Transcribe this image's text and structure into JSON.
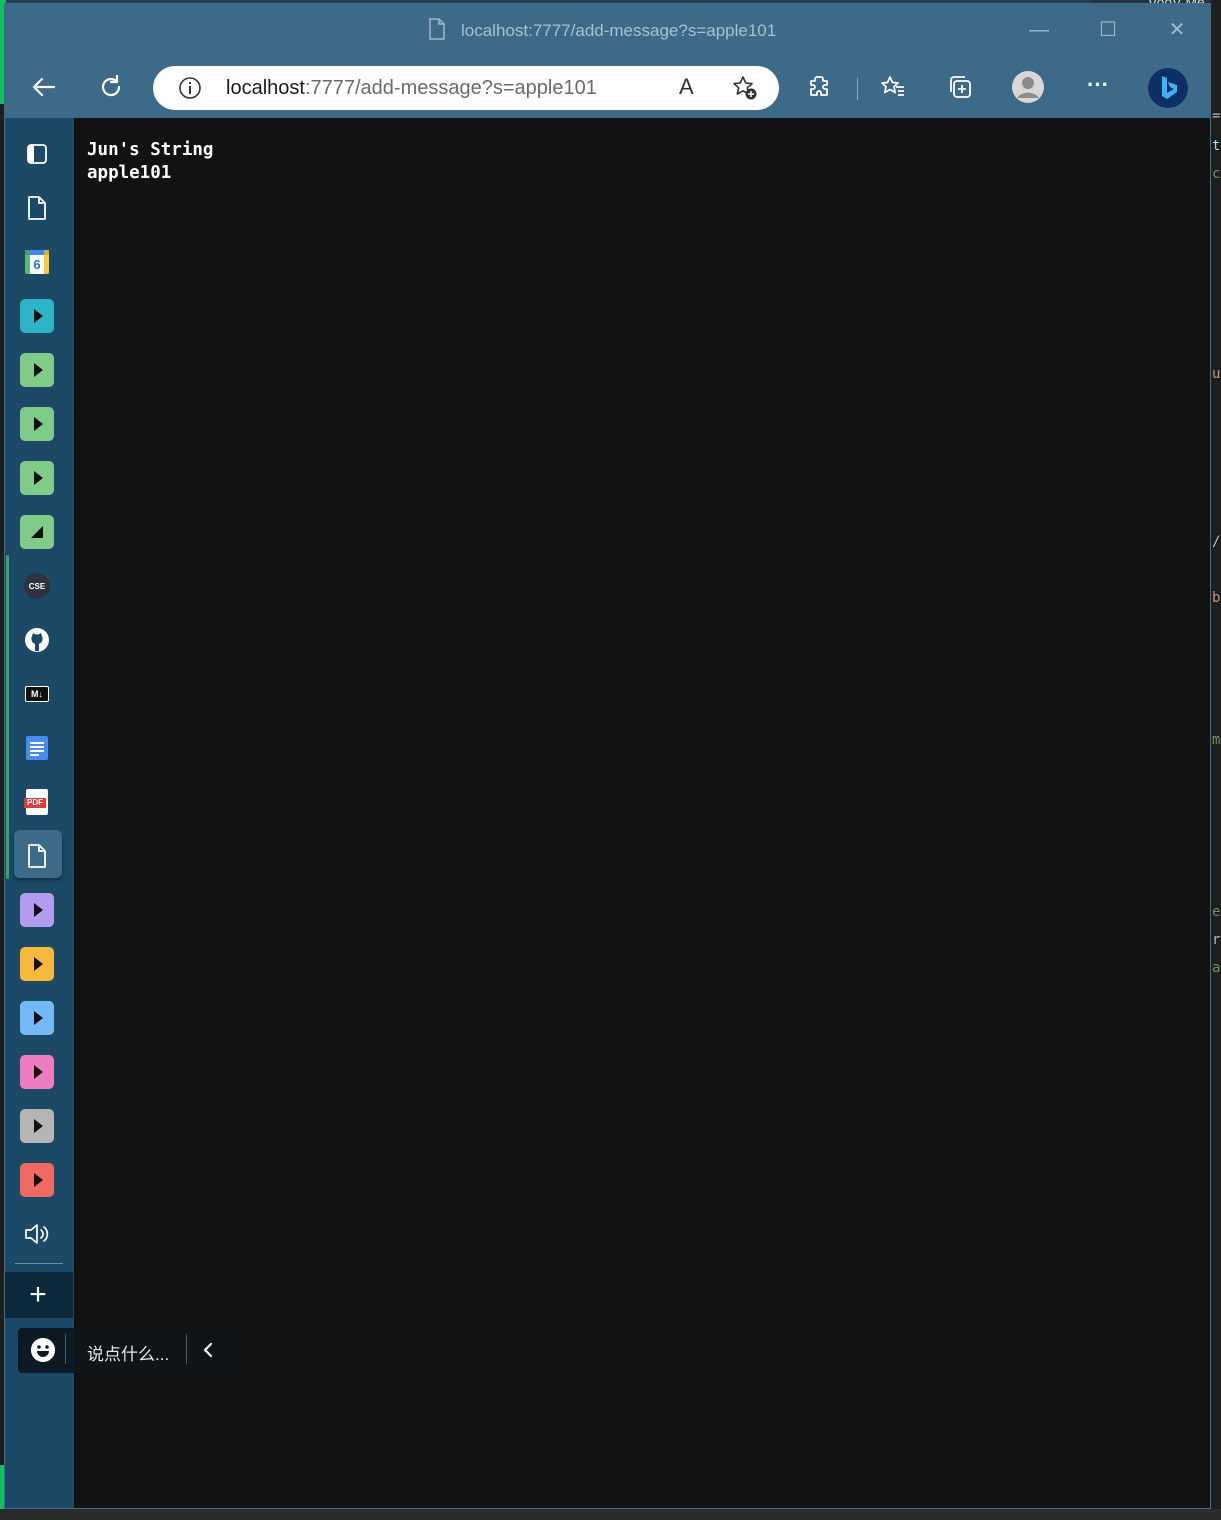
{
  "window": {
    "title": "localhost:7777/add-message?s=apple101",
    "minimize_label": "—",
    "maximize_label": "☐",
    "close_label": "✕"
  },
  "toolbar": {
    "url_host": "localhost",
    "url_rest": ":7777/add-message?s=apple101",
    "icons": [
      "back-icon",
      "refresh-icon",
      "info-icon",
      "read-aloud-icon",
      "add-favorite-icon",
      "extensions-icon",
      "favorites-icon",
      "collections-icon",
      "profile-icon",
      "more-icon",
      "bing-icon"
    ],
    "read_aloud_label": "A",
    "more_label": "···"
  },
  "sidebar": {
    "items": [
      {
        "name": "tab-actions",
        "icon": "tab-actions-icon"
      },
      {
        "name": "page",
        "icon": "page-icon"
      },
      {
        "name": "calendar",
        "icon": "calendar-icon",
        "badge": "6",
        "color": "#4285f4"
      },
      {
        "name": "app-teal",
        "icon": "play-icon",
        "color": "#2cb5c6"
      },
      {
        "name": "app-green-1",
        "icon": "play-icon",
        "color": "#7ecb8a"
      },
      {
        "name": "app-green-2",
        "icon": "play-icon",
        "color": "#7ecb8a"
      },
      {
        "name": "app-green-3",
        "icon": "play-icon",
        "color": "#7ecb8a"
      },
      {
        "name": "app-green-4",
        "icon": "triangle-icon",
        "color": "#7ecb8a"
      },
      {
        "name": "cse",
        "icon": "cse-icon",
        "label": "CSE"
      },
      {
        "name": "github",
        "icon": "github-icon"
      },
      {
        "name": "markdown",
        "icon": "markdown-icon",
        "label": "M↓"
      },
      {
        "name": "docs",
        "icon": "docs-icon",
        "color": "#4a8af4"
      },
      {
        "name": "pdf",
        "icon": "pdf-icon",
        "label": "PDF"
      },
      {
        "name": "page-active",
        "icon": "page-icon"
      },
      {
        "name": "app-purple",
        "icon": "play-icon",
        "color": "#b39cf0"
      },
      {
        "name": "app-yellow",
        "icon": "play-icon",
        "color": "#f6b93b"
      },
      {
        "name": "app-blue",
        "icon": "play-icon",
        "color": "#74b9f5"
      },
      {
        "name": "app-pink",
        "icon": "play-icon",
        "color": "#f07cc0"
      },
      {
        "name": "app-gray",
        "icon": "play-icon",
        "color": "#b5b5b5"
      },
      {
        "name": "app-red",
        "icon": "play-icon",
        "color": "#f06b5f"
      },
      {
        "name": "volume",
        "icon": "volume-icon"
      }
    ],
    "add_label": "+"
  },
  "content": {
    "line1": "Jun's String",
    "line2": "apple101"
  },
  "chat": {
    "placeholder": "说点什么...",
    "collapse_label": "‹"
  },
  "background": {
    "right_chars": [
      "=",
      "t",
      "c",
      "u",
      "/",
      "b",
      "m",
      "e",
      "r",
      "a"
    ],
    "top_right_text": "VooV Me"
  }
}
